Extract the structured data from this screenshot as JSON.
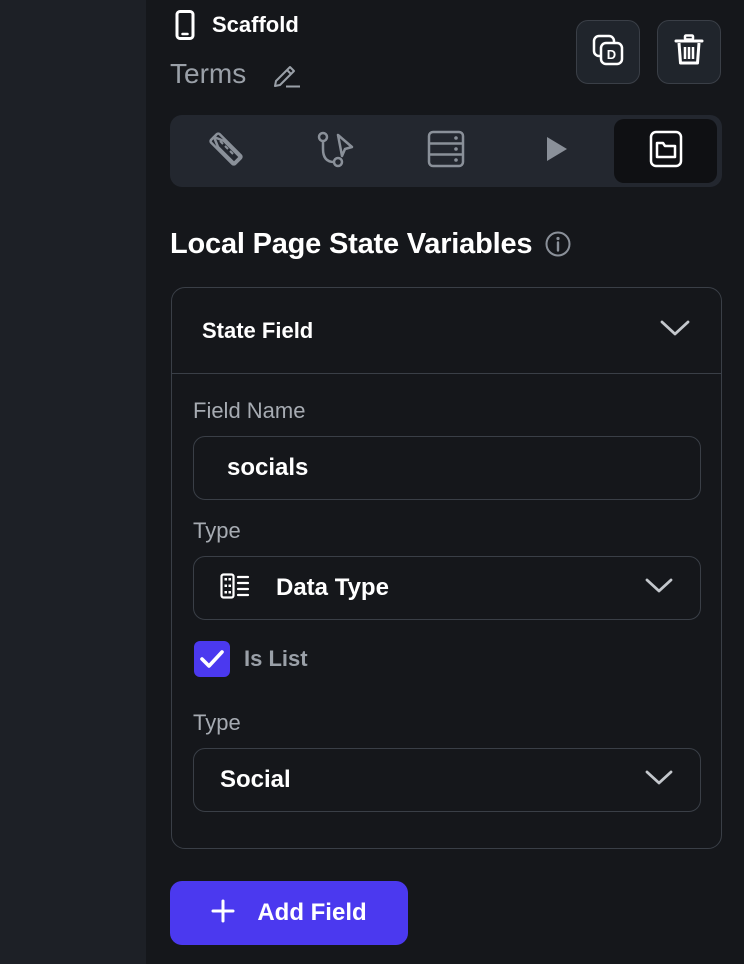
{
  "widget": {
    "icon": "phone-icon",
    "name": "Scaffold"
  },
  "page": {
    "name": "Terms",
    "edit_icon": "pencil-icon"
  },
  "actions": {
    "duplicate_icon": "duplicate-icon",
    "delete_icon": "trash-icon"
  },
  "tabs": [
    {
      "icon": "ruler-pencil-icon",
      "active": false
    },
    {
      "icon": "branch-cursor-icon",
      "active": false
    },
    {
      "icon": "server-icon",
      "active": false
    },
    {
      "icon": "play-icon",
      "active": false
    },
    {
      "icon": "folder-icon",
      "active": true
    }
  ],
  "section": {
    "title": "Local Page State Variables",
    "info_icon": "info-icon"
  },
  "state_field": {
    "header": "State Field",
    "field_name_label": "Field Name",
    "field_name_value": "socials",
    "type_label": "Type",
    "type_value": "Data Type",
    "type_icon": "data-type-icon",
    "is_list_label": "Is List",
    "is_list_checked": true,
    "subtype_label": "Type",
    "subtype_value": "Social"
  },
  "add_field_button": {
    "label": "Add Field",
    "icon": "plus-icon"
  },
  "colors": {
    "accent": "#4b39ef",
    "panel_bg": "#15171b",
    "rail_bg": "#1d2026",
    "border": "#3a3f47",
    "muted_text": "#a6abb2"
  }
}
